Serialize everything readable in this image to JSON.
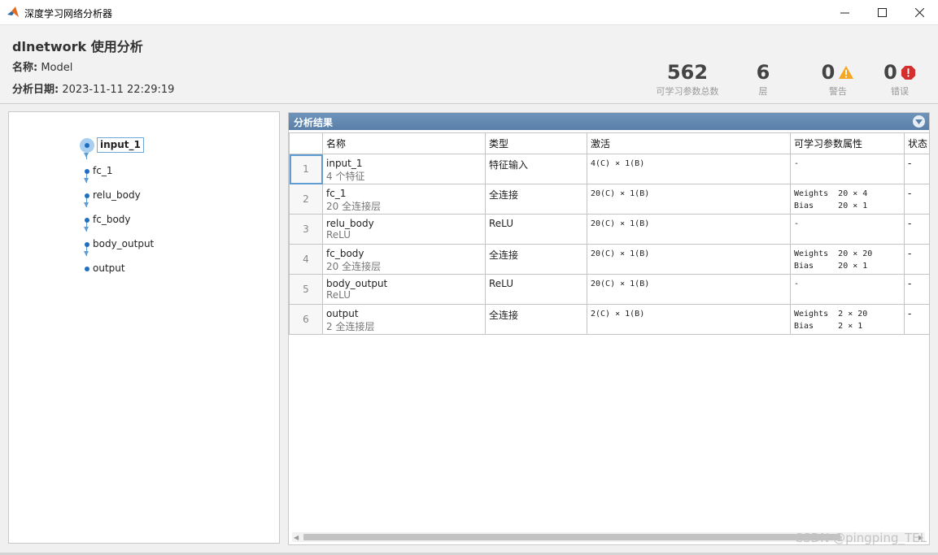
{
  "window": {
    "title": "深度学习网络分析器"
  },
  "header": {
    "title": "dlnetwork 使用分析",
    "name_label": "名称:",
    "name_value": "Model",
    "date_label": "分析日期:",
    "date_value": "2023-11-11 22:29:19",
    "stats": [
      {
        "value": "562",
        "label": "可学习参数总数"
      },
      {
        "value": "6",
        "label": "层"
      },
      {
        "value": "0",
        "label": "警告",
        "icon": "warning-icon",
        "color": "#f5a623"
      },
      {
        "value": "0",
        "label": "错误",
        "icon": "error-icon",
        "color": "#d32f2f"
      }
    ]
  },
  "graph": {
    "nodes": [
      "input_1",
      "fc_1",
      "relu_body",
      "fc_body",
      "body_output",
      "output"
    ],
    "selected": "input_1"
  },
  "results": {
    "title": "分析结果",
    "columns": [
      "",
      "名称",
      "类型",
      "激活",
      "可学习参数属性",
      "状态"
    ],
    "rows": [
      {
        "index": "1",
        "name": "input_1",
        "desc": "4 个特征",
        "type": "特征输入",
        "activation": "4(C) × 1(B)",
        "params": "-",
        "status": "-"
      },
      {
        "index": "2",
        "name": "fc_1",
        "desc": "20 全连接层",
        "type": "全连接",
        "activation": "20(C) × 1(B)",
        "params": "Weights  20 × 4\nBias     20 × 1",
        "status": "-"
      },
      {
        "index": "3",
        "name": "relu_body",
        "desc": "ReLU",
        "type": "ReLU",
        "activation": "20(C) × 1(B)",
        "params": "-",
        "status": "-"
      },
      {
        "index": "4",
        "name": "fc_body",
        "desc": "20 全连接层",
        "type": "全连接",
        "activation": "20(C) × 1(B)",
        "params": "Weights  20 × 20\nBias     20 × 1",
        "status": "-"
      },
      {
        "index": "5",
        "name": "body_output",
        "desc": "ReLU",
        "type": "ReLU",
        "activation": "20(C) × 1(B)",
        "params": "-",
        "status": "-"
      },
      {
        "index": "6",
        "name": "output",
        "desc": "2 全连接层",
        "type": "全连接",
        "activation": "2(C) × 1(B)",
        "params": "Weights  2 × 20\nBias     2 × 1",
        "status": "-"
      }
    ]
  },
  "watermark": "CSDN @pingping_TEL"
}
